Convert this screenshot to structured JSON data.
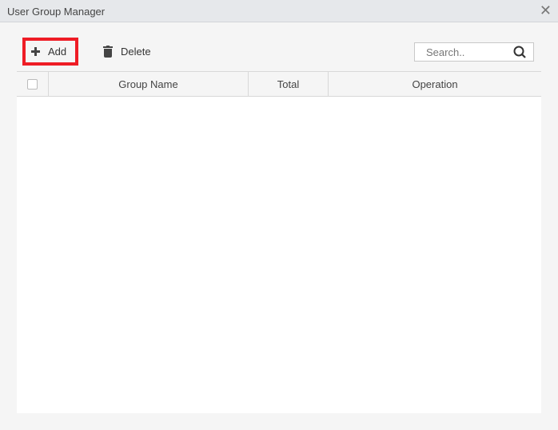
{
  "window": {
    "title": "User Group Manager",
    "close_icon": "close-icon"
  },
  "toolbar": {
    "add_label": "Add",
    "delete_label": "Delete",
    "highlight_color": "#ee1c25"
  },
  "search": {
    "placeholder": "Search..",
    "value": ""
  },
  "table": {
    "columns": [
      "Group Name",
      "Total",
      "Operation"
    ],
    "rows": []
  }
}
